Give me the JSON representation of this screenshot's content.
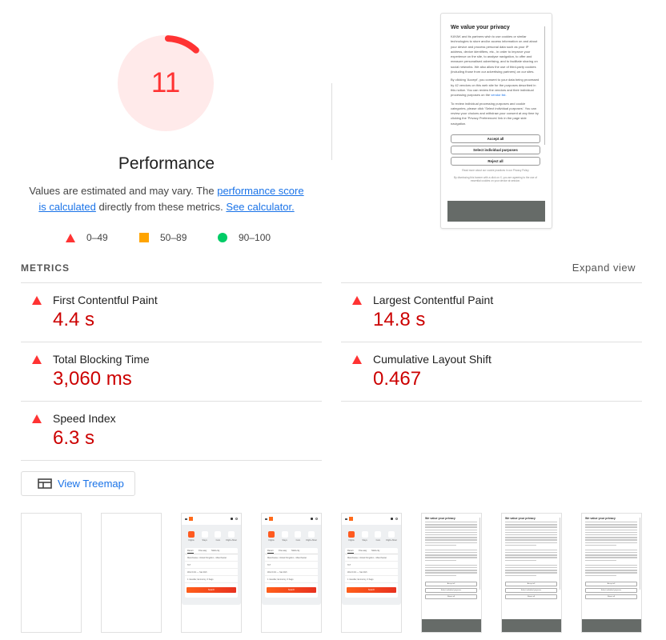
{
  "score": {
    "value": "11",
    "fraction": 0.11,
    "category": "Performance",
    "color": "#ff3333",
    "track_color": "#ffeaea"
  },
  "description": {
    "prefix": "Values are estimated and may vary. The ",
    "link1": "performance score is calculated",
    "middle": " directly from these metrics. ",
    "link2": "See calculator."
  },
  "legend": [
    {
      "icon": "fail-triangle-icon",
      "label": "0–49",
      "color": "#ff3333"
    },
    {
      "icon": "average-square-icon",
      "label": "50–89",
      "color": "#ffa400"
    },
    {
      "icon": "pass-circle-icon",
      "label": "90–100",
      "color": "#00cc66"
    }
  ],
  "final_screenshot": {
    "title": "We value your privacy",
    "paragraphs": [
      "KAYAK and its partners wish to use cookies or similar technologies to store and/or access information on and about your device and process personal data such as your IP address, device identifiers, etc., in order to improve your experience on the site, to analyse navigation, to offer and measure personalised advertising, and to facilitate sharing on social networks. We also allow the use of third-party cookies (including those from our advertising partners) on our sites.",
      "By clicking 'Accept', you consent to your data being processed by 42 vendors on this web site for the purposes described in this notice. You can review the vendors and their individual processing purposes on the",
      "To review individual processing purposes and cookie categories, please click 'Select individual purposes'. You can review your choices and withdraw your consent at any time by clicking the 'Privacy Preferences' link in the page side navigation."
    ],
    "vendor_link": "vendor list.",
    "buttons": [
      "Accept all",
      "Select individual purposes",
      "Reject all"
    ],
    "footer1": "Read more about our cookie practices in our Privacy Policy",
    "footer2": "By dismissing this banner with a click on X, you are agreeing to the use of essential cookies on your device at session."
  },
  "metrics": {
    "header": "METRICS",
    "expand_label": "Expand view",
    "items": [
      {
        "label": "First Contentful Paint",
        "value": "4.4 s",
        "rating": "fail"
      },
      {
        "label": "Largest Contentful Paint",
        "value": "14.8 s",
        "rating": "fail"
      },
      {
        "label": "Total Blocking Time",
        "value": "3,060 ms",
        "rating": "fail"
      },
      {
        "label": "Cumulative Layout Shift",
        "value": "0.467",
        "rating": "fail"
      },
      {
        "label": "Speed Index",
        "value": "6.3 s",
        "rating": "fail"
      }
    ],
    "fail_color": "#cc0000"
  },
  "treemap": {
    "label": "View Treemap",
    "icon": "treemap-icon"
  },
  "filmstrip": {
    "frames": [
      {
        "type": "blank"
      },
      {
        "type": "blank"
      },
      {
        "type": "app"
      },
      {
        "type": "app"
      },
      {
        "type": "app"
      },
      {
        "type": "privacy"
      },
      {
        "type": "privacy"
      },
      {
        "type": "privacy"
      }
    ],
    "app": {
      "categories": [
        "Flights",
        "Stays",
        "Cars",
        "Flight+Hotel"
      ],
      "tabs": [
        "Return",
        "One-way",
        "Multi-city"
      ],
      "rows": [
        "Manchester, United Kingdom - Manchester",
        "To?",
        "Wed 13/1 — Sat 20/1",
        "1 traveller, Economy, 0 bags"
      ],
      "search_label": "Search"
    },
    "privacy": {
      "title": "We value your privacy",
      "buttons": [
        "Accept all",
        "Select individual purposes",
        "Reject all"
      ]
    }
  }
}
